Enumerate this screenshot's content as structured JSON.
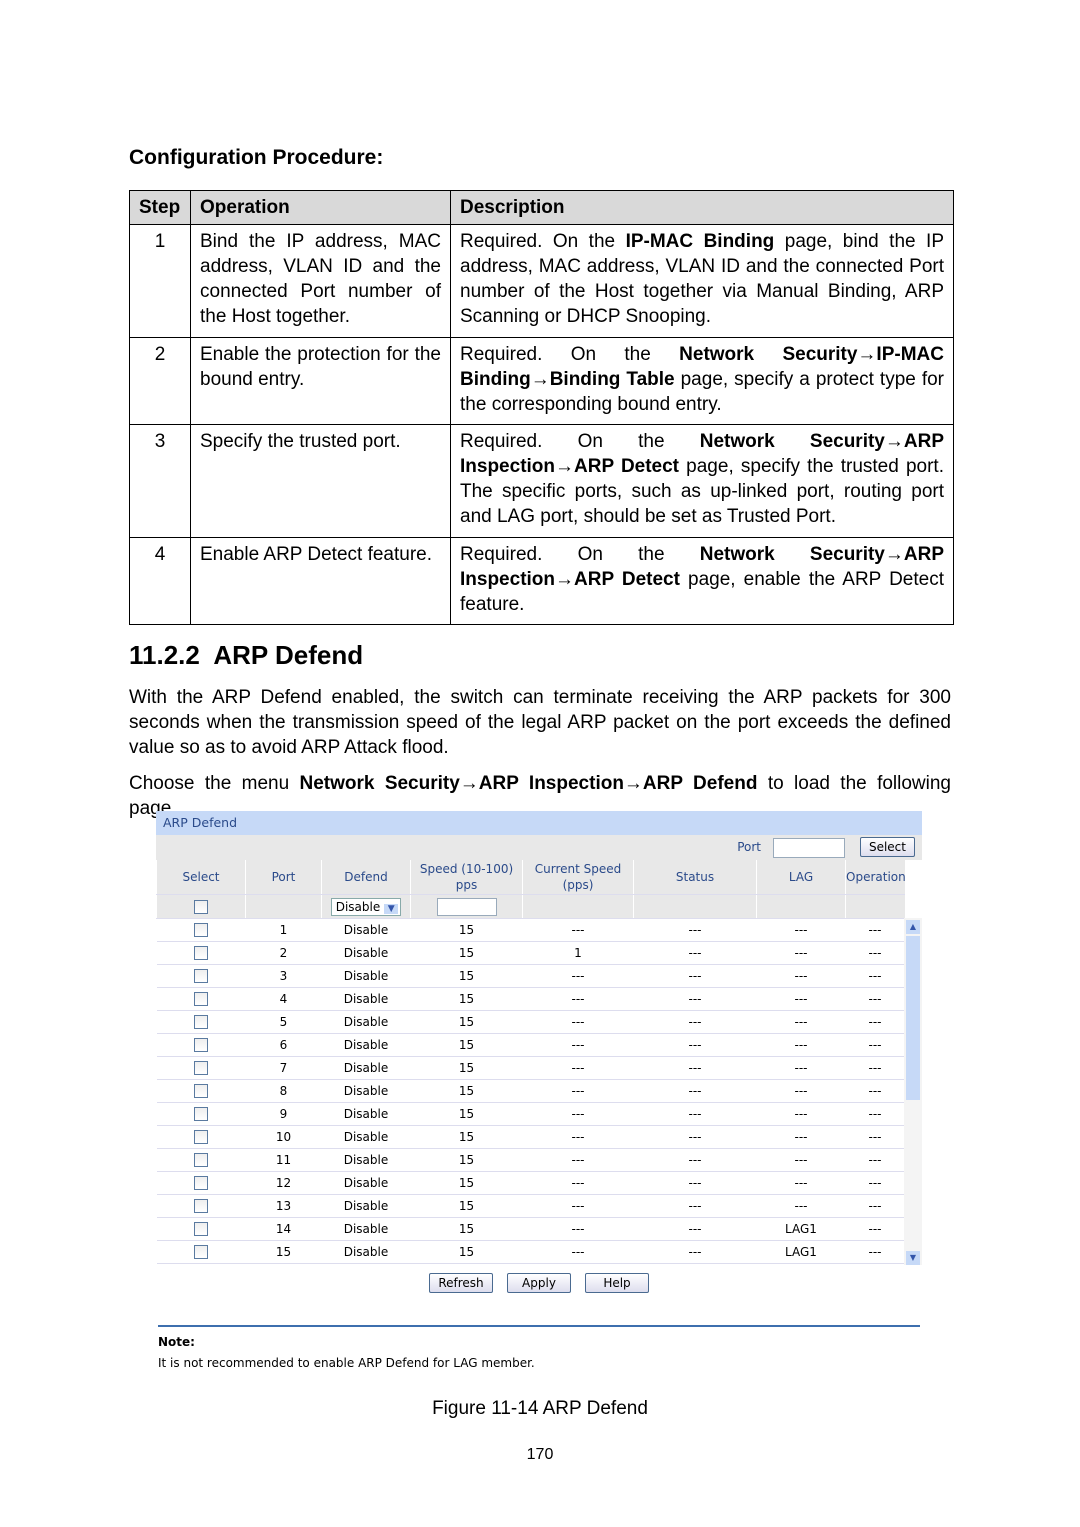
{
  "heading": "Configuration Procedure:",
  "proc": {
    "headers": [
      "Step",
      "Operation",
      "Description"
    ],
    "rows": [
      {
        "step": "1",
        "op": "Bind the IP address, MAC address, VLAN ID and the connected Port number of the Host together.",
        "desc": [
          {
            "t": "Required. On the "
          },
          {
            "t": "IP-MAC Binding",
            "b": 1
          },
          {
            "t": " page, bind the IP address, MAC address, VLAN ID and the connected Port number of the Host together via Manual Binding, ARP Scanning or DHCP Snooping."
          }
        ]
      },
      {
        "step": "2",
        "op": "Enable the protection for the bound entry.",
        "desc": [
          {
            "t": "Required. On the "
          },
          {
            "t": "Network Security→IP-MAC Binding→Binding Table",
            "b": 1
          },
          {
            "t": " page, specify a protect type for the corresponding bound entry."
          }
        ]
      },
      {
        "step": "3",
        "op": "Specify the trusted port.",
        "desc": [
          {
            "t": "Required. On the "
          },
          {
            "t": "Network Security→ARP Inspection→ARP Detect",
            "b": 1
          },
          {
            "t": " page, specify the trusted port. The specific ports, such as up-linked port, routing port and LAG port, should be set as Trusted Port."
          }
        ]
      },
      {
        "step": "4",
        "op": "Enable ARP Detect feature.",
        "desc": [
          {
            "t": "Required. On the "
          },
          {
            "t": "Network Security→ARP Inspection→ARP Detect",
            "b": 1
          },
          {
            "t": " page, enable the ARP Detect feature."
          }
        ]
      }
    ]
  },
  "section": "11.2.2  ARP Defend",
  "para1": "With the ARP Defend enabled, the switch can terminate receiving the ARP packets for 300 seconds when the transmission speed of the legal ARP packet on the port exceeds the defined value so as to avoid ARP Attack flood.",
  "para2": [
    {
      "t": "Choose the menu "
    },
    {
      "t": "Network Security→ARP Inspection→ARP Defend",
      "b": 1
    },
    {
      "t": " to load the following page."
    }
  ],
  "ui": {
    "title": "ARP Defend",
    "port_label": "Port",
    "select_btn": "Select",
    "columns": [
      "Select",
      "Port",
      "Defend",
      "Speed (10-100) pps",
      "Current Speed (pps)",
      "Status",
      "LAG",
      "Operation"
    ],
    "filter_defend": "Disable",
    "rows": [
      [
        "1",
        "Disable",
        "15",
        "---",
        "---",
        "---",
        "---"
      ],
      [
        "2",
        "Disable",
        "15",
        "1",
        "---",
        "---",
        "---"
      ],
      [
        "3",
        "Disable",
        "15",
        "---",
        "---",
        "---",
        "---"
      ],
      [
        "4",
        "Disable",
        "15",
        "---",
        "---",
        "---",
        "---"
      ],
      [
        "5",
        "Disable",
        "15",
        "---",
        "---",
        "---",
        "---"
      ],
      [
        "6",
        "Disable",
        "15",
        "---",
        "---",
        "---",
        "---"
      ],
      [
        "7",
        "Disable",
        "15",
        "---",
        "---",
        "---",
        "---"
      ],
      [
        "8",
        "Disable",
        "15",
        "---",
        "---",
        "---",
        "---"
      ],
      [
        "9",
        "Disable",
        "15",
        "---",
        "---",
        "---",
        "---"
      ],
      [
        "10",
        "Disable",
        "15",
        "---",
        "---",
        "---",
        "---"
      ],
      [
        "11",
        "Disable",
        "15",
        "---",
        "---",
        "---",
        "---"
      ],
      [
        "12",
        "Disable",
        "15",
        "---",
        "---",
        "---",
        "---"
      ],
      [
        "13",
        "Disable",
        "15",
        "---",
        "---",
        "---",
        "---"
      ],
      [
        "14",
        "Disable",
        "15",
        "---",
        "---",
        "LAG1",
        "---"
      ],
      [
        "15",
        "Disable",
        "15",
        "---",
        "---",
        "LAG1",
        "---"
      ]
    ],
    "buttons": [
      "Refresh",
      "Apply",
      "Help"
    ],
    "note_title": "Note:",
    "note": "It is not recommended to enable ARP Defend for LAG member."
  },
  "caption": "Figure 11-14 ARP Defend",
  "page_number": "170"
}
